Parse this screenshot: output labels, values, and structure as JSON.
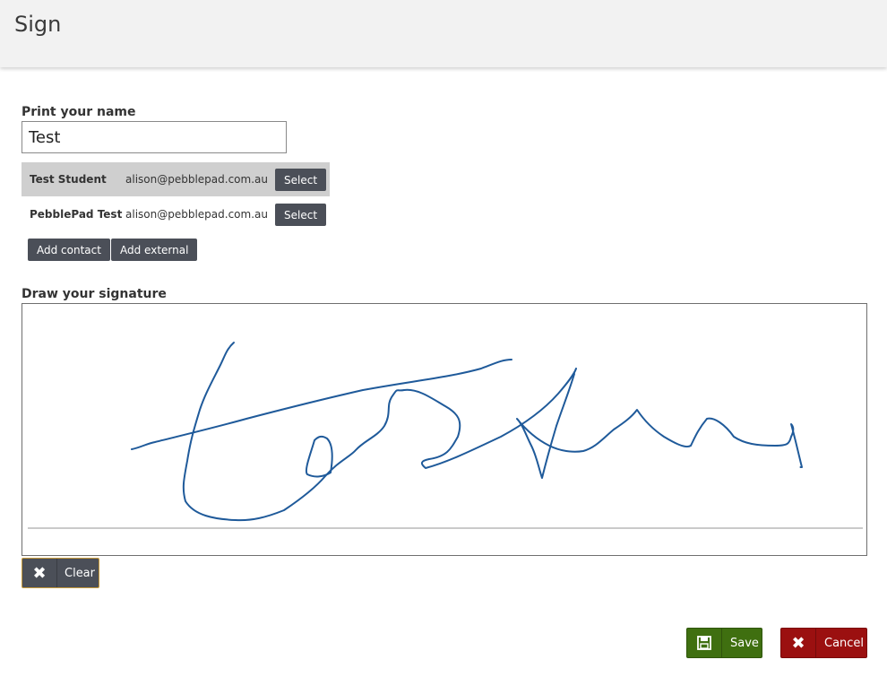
{
  "header": {
    "title": "Sign"
  },
  "name_section": {
    "label": "Print your name",
    "input_value": "Test"
  },
  "contacts": [
    {
      "name": "Test Student",
      "email": "alison@pebblepad.com.au",
      "action": "Select",
      "selected": true
    },
    {
      "name": "PebblePad Test",
      "email": "alison@pebblepad.com.au",
      "action": "Select",
      "selected": false
    }
  ],
  "contact_actions": {
    "add_contact": "Add contact",
    "add_external": "Add external"
  },
  "signature": {
    "label": "Draw your signature",
    "ink_color": "#1f5a9a",
    "clear_label": "Clear"
  },
  "footer": {
    "save_label": "Save",
    "cancel_label": "Cancel",
    "save_color": "#3f6f10",
    "cancel_color": "#9b1010"
  },
  "icons": {
    "clear": "close-icon",
    "save": "floppy-disk-icon",
    "cancel": "close-icon"
  }
}
